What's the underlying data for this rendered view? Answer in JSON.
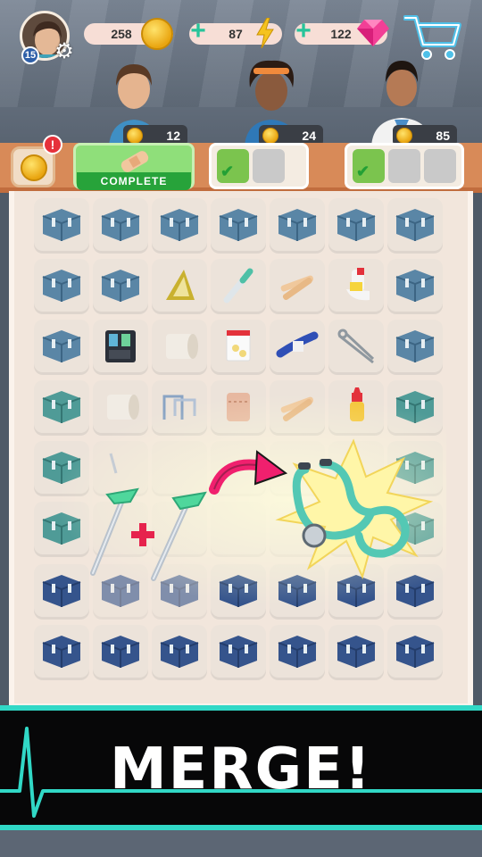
{
  "player": {
    "level": "15"
  },
  "currencies": {
    "coins": "258",
    "energy": "87",
    "gems": "122"
  },
  "icons": {
    "settings": "gear-icon",
    "coin": "coin-icon",
    "energy": "lightning-icon",
    "gem": "gem-icon",
    "shop": "cart-icon",
    "add": "plus-icon"
  },
  "orders": [
    {
      "reward": "12",
      "status_label": "COMPLETE"
    },
    {
      "reward": "24"
    },
    {
      "reward": "85"
    }
  ],
  "alert": {
    "mark": "!"
  },
  "banner": {
    "text": "MERGE!"
  },
  "colors": {
    "accent_teal": "#31d8c6",
    "order_strip": "#d88a58",
    "complete_green": "#27a33a",
    "merge_arrow": "#f0206e"
  }
}
